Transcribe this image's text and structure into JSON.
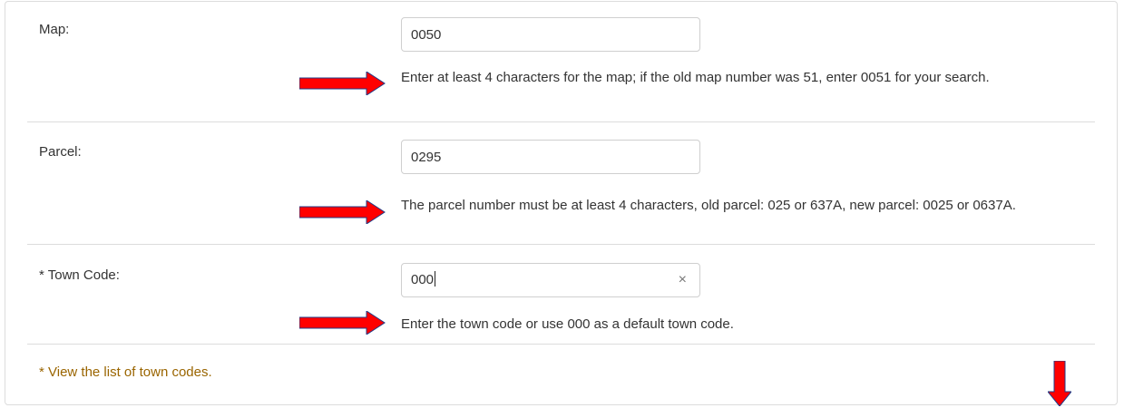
{
  "fields": [
    {
      "label": "Map:",
      "value": "0050",
      "help": "Enter at least 4 characters for the map; if the old map number was 51, enter 0051 for your search."
    },
    {
      "label": "Parcel:",
      "value": "0295",
      "help": "The parcel number must be at least 4 characters, old parcel: 025 or 637A, new parcel: 0025 or 0637A."
    },
    {
      "label": "* Town Code:",
      "value": "000",
      "clear_glyph": "×",
      "help": "Enter the town code or use 000 as a default town code."
    }
  ],
  "footer": {
    "link_text": "* View the list of town codes."
  },
  "colors": {
    "arrow": "#ff0000",
    "link": "#9a6500",
    "border": "#dcdcdc"
  },
  "icons": [
    "right-arrow-icon",
    "down-arrow-icon",
    "clear-icon"
  ]
}
